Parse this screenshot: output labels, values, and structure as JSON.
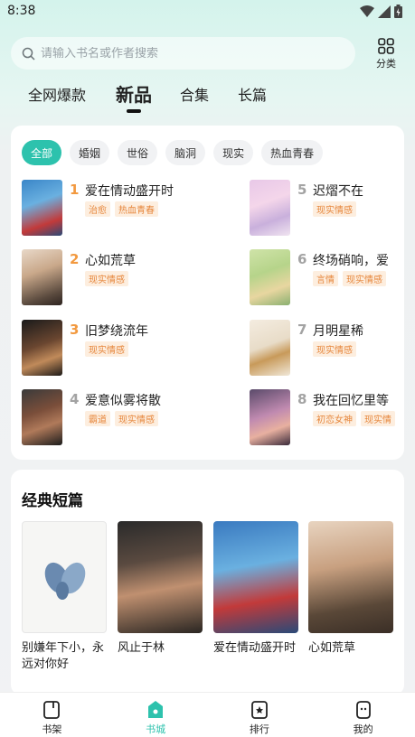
{
  "status": {
    "time": "8:38"
  },
  "search": {
    "placeholder": "请输入书名或作者搜索"
  },
  "category_btn": {
    "label": "分类"
  },
  "tabs": [
    "全网爆款",
    "新品",
    "合集",
    "长篇"
  ],
  "filters": [
    "全部",
    "婚姻",
    "世俗",
    "脑洞",
    "现实",
    "热血青春"
  ],
  "rank_list": [
    {
      "num": "1",
      "title": "爱在情动盛开时",
      "tags": [
        "治愈",
        "热血青春"
      ]
    },
    {
      "num": "2",
      "title": "心如荒草",
      "tags": [
        "现实情感"
      ]
    },
    {
      "num": "3",
      "title": "旧梦绕流年",
      "tags": [
        "现实情感"
      ]
    },
    {
      "num": "4",
      "title": "爱意似雾将散",
      "tags": [
        "霸道",
        "现实情感"
      ]
    },
    {
      "num": "5",
      "title": "迟熠不在",
      "tags": [
        "现实情感"
      ]
    },
    {
      "num": "6",
      "title": "终场硝响，爱",
      "tags": [
        "言情",
        "现实情感"
      ]
    },
    {
      "num": "7",
      "title": "月明星稀",
      "tags": [
        "现实情感"
      ]
    },
    {
      "num": "8",
      "title": "我在回忆里等",
      "tags": [
        "初恋女神",
        "现实情"
      ]
    }
  ],
  "classic": {
    "title": "经典短篇",
    "books": [
      {
        "title": "别嫌年下小，永远对你好"
      },
      {
        "title": "风止于林"
      },
      {
        "title": "爱在情动盛开时"
      },
      {
        "title": "心如荒草"
      }
    ]
  },
  "nav": [
    "书架",
    "书城",
    "排行",
    "我的"
  ],
  "colors": {
    "accent": "#2dc2ad",
    "rank_top": "#f2993f",
    "rank_other": "#a3a3a3",
    "tag_text": "#e6863b",
    "tag_bg": "#fdeedf"
  }
}
